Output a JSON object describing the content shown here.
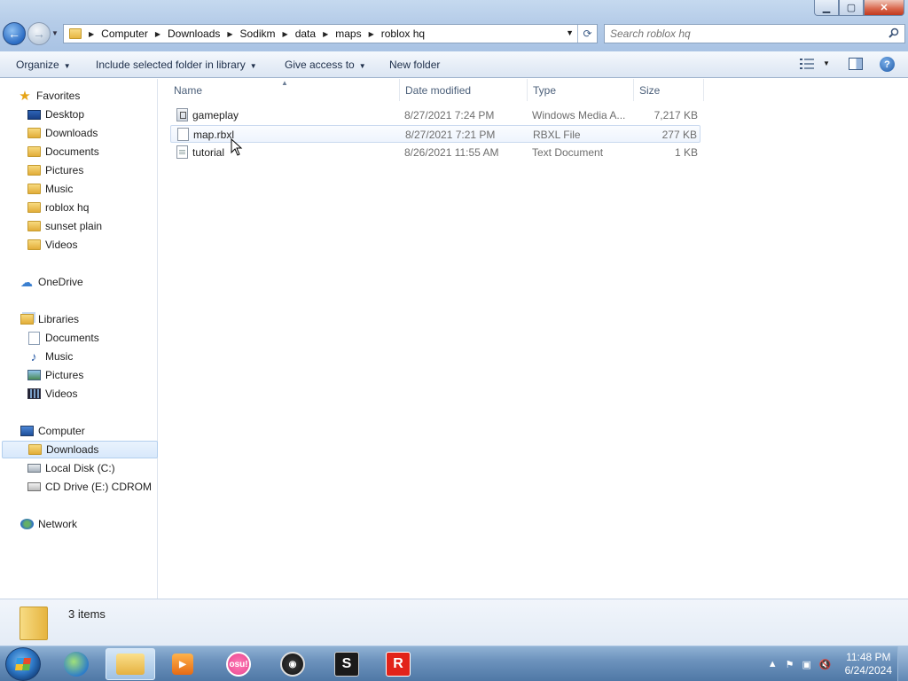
{
  "window": {
    "min_label": "▁",
    "max_label": "▢",
    "close_label": "✕"
  },
  "address": {
    "crumbs": [
      "Computer",
      "Downloads",
      "Sodikm",
      "data",
      "maps",
      "roblox hq"
    ]
  },
  "search": {
    "placeholder": "Search roblox hq"
  },
  "toolbar": {
    "organize": "Organize",
    "include": "Include selected folder in library",
    "give_access": "Give access to",
    "new_folder": "New folder"
  },
  "nav": {
    "favorites": "Favorites",
    "desktop": "Desktop",
    "downloads": "Downloads",
    "documents": "Documents",
    "pictures": "Pictures",
    "music": "Music",
    "roblox_hq": "roblox hq",
    "sunset_plain": "sunset plain",
    "videos": "Videos",
    "onedrive": "OneDrive",
    "libraries": "Libraries",
    "lib_documents": "Documents",
    "lib_music": "Music",
    "lib_pictures": "Pictures",
    "lib_videos": "Videos",
    "computer": "Computer",
    "comp_downloads": "Downloads",
    "local_disk": "Local Disk (C:)",
    "cd_drive": "CD Drive (E:) CDROM",
    "network": "Network"
  },
  "columns": {
    "name": "Name",
    "date": "Date modified",
    "type": "Type",
    "size": "Size"
  },
  "files": [
    {
      "name": "gameplay",
      "date": "8/27/2021 7:24 PM",
      "type": "Windows Media A...",
      "size": "7,217 KB",
      "icon": "media-file-icon"
    },
    {
      "name": "map.rbxl",
      "date": "8/27/2021 7:21 PM",
      "type": "RBXL File",
      "size": "277 KB",
      "icon": "blank-file-icon"
    },
    {
      "name": "tutorial",
      "date": "8/26/2021 11:55 AM",
      "type": "Text Document",
      "size": "1 KB",
      "icon": "text-file-icon"
    }
  ],
  "status": {
    "item_count": "3 items"
  },
  "taskbar": {
    "osu_label": "osu!",
    "time": "11:48 PM",
    "date": "6/24/2024"
  }
}
